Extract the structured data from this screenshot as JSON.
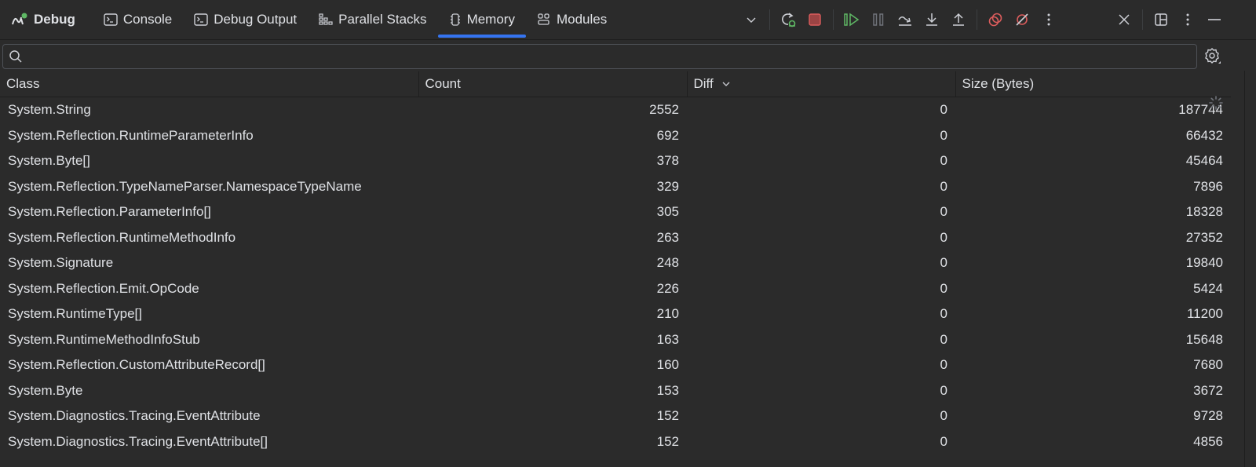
{
  "toolbar": {
    "title": "Debug",
    "tabs": [
      {
        "label": "Console",
        "icon": "terminal-icon",
        "active": false
      },
      {
        "label": "Debug Output",
        "icon": "terminal-icon",
        "active": false
      },
      {
        "label": "Parallel Stacks",
        "icon": "parallel-stacks-icon",
        "active": false
      },
      {
        "label": "Memory",
        "icon": "memory-chip-icon",
        "active": true
      },
      {
        "label": "Modules",
        "icon": "modules-icon",
        "active": false
      }
    ],
    "accent_color": "#3574f0",
    "actions": [
      "more-tabs",
      "rerun",
      "stop",
      "resume",
      "pause",
      "step-over",
      "step-into",
      "step-out",
      "view-breakpoints",
      "mute-breakpoints",
      "more-options",
      "close",
      "layout",
      "options",
      "minimize"
    ]
  },
  "search": {
    "value": "",
    "placeholder": ""
  },
  "table": {
    "columns": [
      "Class",
      "Count",
      "Diff",
      "Size (Bytes)"
    ],
    "sorted_column": "Diff",
    "rows": [
      {
        "class": "System.String",
        "count": "2552",
        "diff": "0",
        "size": "187744"
      },
      {
        "class": "System.Reflection.RuntimeParameterInfo",
        "count": "692",
        "diff": "0",
        "size": "66432"
      },
      {
        "class": "System.Byte[]",
        "count": "378",
        "diff": "0",
        "size": "45464"
      },
      {
        "class": "System.Reflection.TypeNameParser.NamespaceTypeName",
        "count": "329",
        "diff": "0",
        "size": "7896"
      },
      {
        "class": "System.Reflection.ParameterInfo[]",
        "count": "305",
        "diff": "0",
        "size": "18328"
      },
      {
        "class": "System.Reflection.RuntimeMethodInfo",
        "count": "263",
        "diff": "0",
        "size": "27352"
      },
      {
        "class": "System.Signature",
        "count": "248",
        "diff": "0",
        "size": "19840"
      },
      {
        "class": "System.Reflection.Emit.OpCode",
        "count": "226",
        "diff": "0",
        "size": "5424"
      },
      {
        "class": "System.RuntimeType[]",
        "count": "210",
        "diff": "0",
        "size": "11200"
      },
      {
        "class": "System.RuntimeMethodInfoStub",
        "count": "163",
        "diff": "0",
        "size": "15648"
      },
      {
        "class": "System.Reflection.CustomAttributeRecord[]",
        "count": "160",
        "diff": "0",
        "size": "7680"
      },
      {
        "class": "System.Byte",
        "count": "153",
        "diff": "0",
        "size": "3672"
      },
      {
        "class": "System.Diagnostics.Tracing.EventAttribute",
        "count": "152",
        "diff": "0",
        "size": "9728"
      },
      {
        "class": "System.Diagnostics.Tracing.EventAttribute[]",
        "count": "152",
        "diff": "0",
        "size": "4856"
      }
    ]
  }
}
